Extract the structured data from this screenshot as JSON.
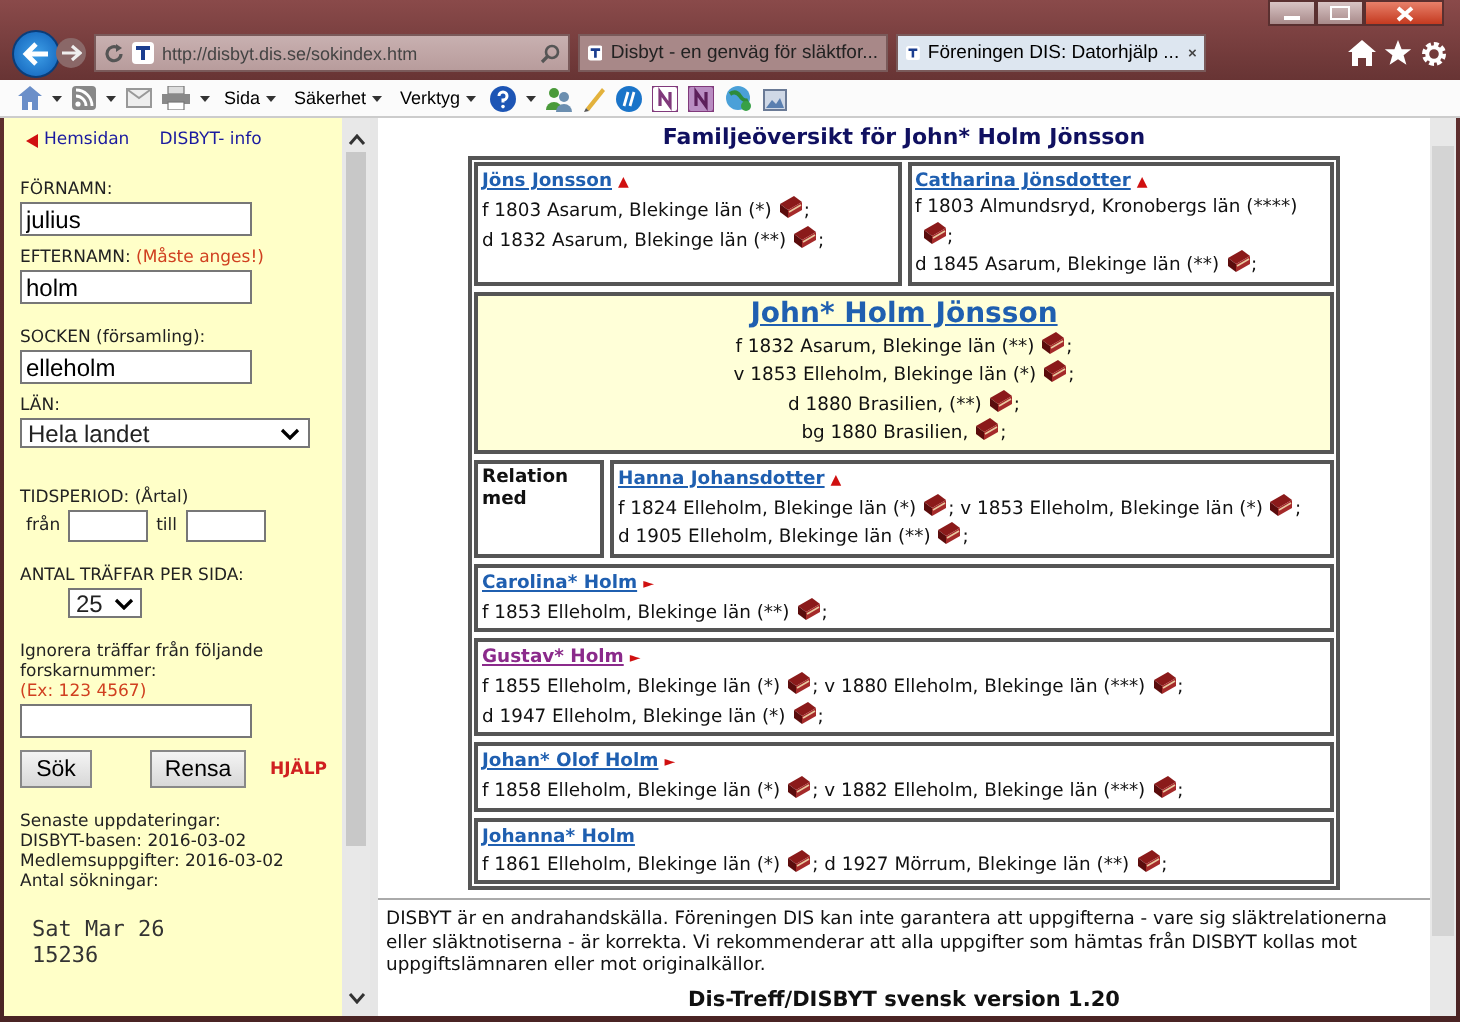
{
  "browser": {
    "address": "http://disbyt.dis.se/sokindex.htm",
    "tabs": [
      {
        "label": "Disbyt - en genväg för släktfor...",
        "selected": false
      },
      {
        "label": "Föreningen DIS: Datorhjälp ...",
        "selected": true
      }
    ],
    "menus": [
      "Sida",
      "Säkerhet",
      "Verktyg"
    ]
  },
  "sidebar": {
    "links": [
      "Hemsidan",
      "DISBYT- info"
    ],
    "first_name": {
      "label": "FÖRNAMN:",
      "value": "julius"
    },
    "last_name": {
      "label": "EFTERNAMN:",
      "note": "(Måste anges!)",
      "value": "holm"
    },
    "parish": {
      "label": "SOCKEN (församling):",
      "value": "elleholm"
    },
    "county": {
      "label": "LÄN:",
      "value": "Hela landet"
    },
    "period": {
      "label": "TIDSPERIOD: (Årtal)",
      "from": "från",
      "to": "till"
    },
    "hits": {
      "label": "ANTAL TRÄFFAR PER SIDA:",
      "value": "25"
    },
    "ignore": {
      "label": "Ignorera träffar från följande forskarnummer:",
      "example": "(Ex: 123 4567)"
    },
    "buttons": [
      "Sök",
      "Rensa"
    ],
    "help": "HJÄLP",
    "updates": [
      "Senaste uppdateringar:",
      "DISBYT-basen:  2016-03-02",
      "Medlemsuppgifter: 2016-03-02",
      "Antal sökningar:"
    ],
    "counter": [
      "Sat Mar 26",
      "15236"
    ]
  },
  "main": {
    "title": "Familjeöversikt för John* Holm Jönsson",
    "parents": [
      {
        "name": "Jöns Jonsson",
        "marker": "▲",
        "facts": [
          {
            "text": "f 1803 Asarum, Blekinge län (*)",
            "after": ";"
          },
          {
            "text": "d 1832 Asarum, Blekinge län (**)",
            "after": ";"
          }
        ]
      },
      {
        "name": "Catharina Jönsdotter",
        "marker": "▲",
        "facts": [
          {
            "text": "f 1803 Almundsryd, Kronobergs län (****)",
            "after": ";"
          },
          {
            "text": "d 1845 Asarum, Blekinge län (**)",
            "after": ";"
          }
        ]
      }
    ],
    "person": {
      "name": "John* Holm Jönsson",
      "facts": [
        {
          "text": "f 1832 Asarum, Blekinge län (**)",
          "after": ";"
        },
        {
          "text": "v 1853 Elleholm, Blekinge län (*)",
          "after": ";"
        },
        {
          "text": "d 1880 Brasilien,   (**)",
          "after": ";"
        },
        {
          "text": "bg 1880 Brasilien,",
          "after": ";"
        }
      ]
    },
    "relation": {
      "label": "Relation med",
      "spouse": {
        "name": "Hanna Johansdotter",
        "marker": "▲",
        "facts": [
          {
            "text": "f 1824 Elleholm, Blekinge län (*)",
            "after": ";"
          },
          {
            "text": "v 1853 Elleholm, Blekinge län (*)",
            "after": ";"
          },
          {
            "text": "d 1905 Elleholm, Blekinge län (**)",
            "after": ";"
          }
        ]
      }
    },
    "children": [
      {
        "name": "Carolina* Holm",
        "marker": "►",
        "visited": false,
        "facts": [
          {
            "text": "f 1853 Elleholm, Blekinge län (**)",
            "after": ";"
          }
        ]
      },
      {
        "name": "Gustav* Holm",
        "marker": "►",
        "visited": true,
        "facts": [
          {
            "text": "f 1855 Elleholm, Blekinge län (*)",
            "after": ";"
          },
          {
            "text": "v 1880 Elleholm, Blekinge län (***)",
            "after": ";"
          },
          {
            "text": "d 1947 Elleholm, Blekinge län (*)",
            "after": ";"
          }
        ]
      },
      {
        "name": "Johan* Olof Holm",
        "marker": "►",
        "visited": false,
        "facts": [
          {
            "text": "f 1858 Elleholm, Blekinge län (*)",
            "after": ";"
          },
          {
            "text": "v 1882 Elleholm, Blekinge län (***)",
            "after": ";"
          }
        ]
      },
      {
        "name": "Johanna* Holm",
        "visited": false,
        "facts": [
          {
            "text": "f 1861 Elleholm, Blekinge län (*)",
            "after": ";"
          },
          {
            "text": "d 1927 Mörrum, Blekinge län (**)",
            "after": ";"
          }
        ]
      }
    ],
    "disclaimer": "DISBYT är en andrahandskälla. Föreningen DIS kan inte garantera att uppgifterna - vare sig släktrelationerna eller släktnotiserna - är korrekta. Vi rekommenderar att alla uppgifter som hämtas från DISBYT kollas mot uppgiftslämnaren eller mot originalkällor.",
    "version": "Dis-Treff/DISBYT svensk version 1.20"
  }
}
